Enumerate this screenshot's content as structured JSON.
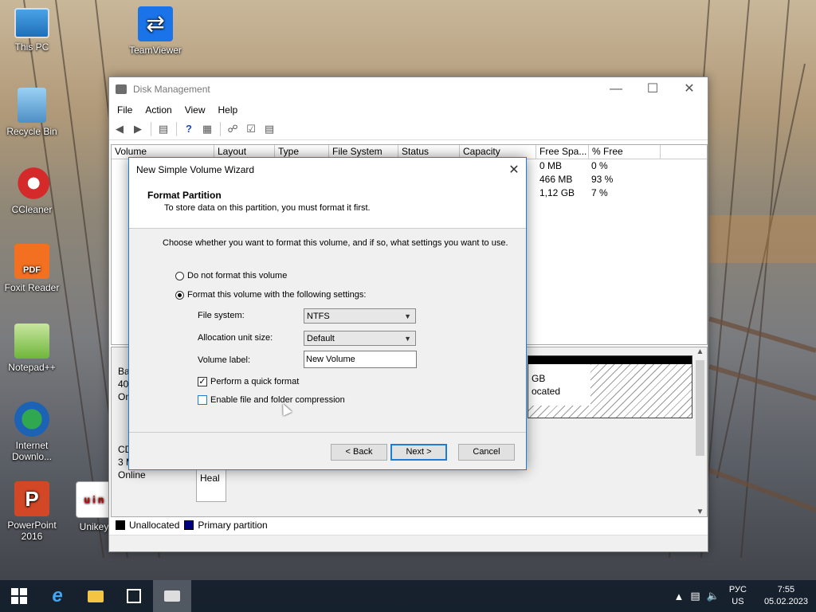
{
  "desktop": {
    "icons": [
      {
        "label": "This PC",
        "icon": "computer-icon"
      },
      {
        "label": "TeamViewer",
        "icon": "teamviewer-icon"
      },
      {
        "label": "Recycle Bin",
        "icon": "recycle-bin-icon"
      },
      {
        "label": "CCleaner",
        "icon": "ccleaner-icon"
      },
      {
        "label": "Foxit Reader",
        "icon": "foxit-reader-icon"
      },
      {
        "label": "Notepad++",
        "icon": "notepad-plus-plus-icon"
      },
      {
        "label": "Internet Downlo...",
        "icon": "internet-download-manager-icon"
      },
      {
        "label": "PowerPoint 2016",
        "icon": "powerpoint-icon"
      },
      {
        "label": "Unikey",
        "icon": "unikey-icon"
      }
    ]
  },
  "disk_management": {
    "title": "Disk Management",
    "menu": [
      "File",
      "Action",
      "View",
      "Help"
    ],
    "columns": [
      "Volume",
      "Layout",
      "Type",
      "File System",
      "Status",
      "Capacity",
      "Free Spa...",
      "% Free"
    ],
    "rows": [
      {
        "free": "0 MB",
        "pct": "0 %"
      },
      {
        "free": "466 MB",
        "pct": "93 %"
      },
      {
        "free": "1,12 GB",
        "pct": "7 %"
      }
    ],
    "disk0_lines": [
      "Ba",
      "40,",
      "On"
    ],
    "cd_lines": [
      "CD",
      "3 M",
      "Online"
    ],
    "unalloc_lines": [
      "GB",
      "ocated"
    ],
    "heal_text": "Heal",
    "legend": [
      "Unallocated",
      "Primary partition"
    ],
    "colors": {
      "unallocated": "#000000",
      "primary": "#00007f"
    }
  },
  "wizard": {
    "title": "New Simple Volume Wizard",
    "heading": "Format Partition",
    "subheading": "To store data on this partition, you must format it first.",
    "intro": "Choose whether you want to format this volume, and if so, what settings you want to use.",
    "radio_no_format": "Do not format this volume",
    "radio_format": "Format this volume with the following settings:",
    "file_system_label": "File system:",
    "file_system_value": "NTFS",
    "alloc_label": "Allocation unit size:",
    "alloc_value": "Default",
    "volume_label_label": "Volume label:",
    "volume_label_value": "New Volume",
    "quick_format_label": "Perform a quick format",
    "quick_format_checked": true,
    "compression_label": "Enable file and folder compression",
    "compression_checked": false,
    "back_button": "< Back",
    "next_button": "Next >",
    "cancel_button": "Cancel",
    "accent": "#1f7cd6"
  },
  "taskbar": {
    "language": "РУС",
    "layout": "US",
    "time": "7:55",
    "date": "05.02.2023"
  }
}
